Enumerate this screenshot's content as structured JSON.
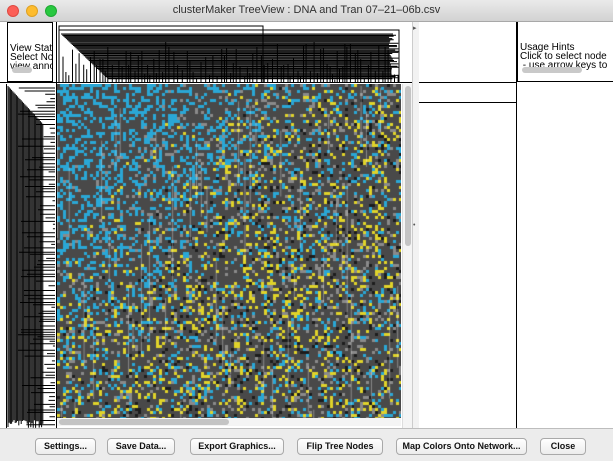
{
  "window": {
    "title": "clusterMaker TreeView : DNA and Tran 07–21–06b.csv"
  },
  "status_left": {
    "text": "View Stat\nSelect No\nview anno"
  },
  "usage_hints": {
    "text": "Usage Hints\nClick to select node\n - use arrow keys to"
  },
  "buttons": {
    "settings": "Settings...",
    "save_data": "Save Data...",
    "export_graphics": "Export Graphics...",
    "flip_tree": "Flip Tree Nodes",
    "map_colors": "Map Colors Onto Network...",
    "close": "Close"
  },
  "colors": {
    "heatmap_background": "#494949",
    "heatmap_blue": "#2aa7d6",
    "heatmap_yellow": "#e0d32a",
    "heatmap_white": "#ffffff"
  },
  "icons": {
    "close": "close-window-icon",
    "minimize": "minimize-window-icon",
    "zoom": "zoom-window-icon"
  }
}
